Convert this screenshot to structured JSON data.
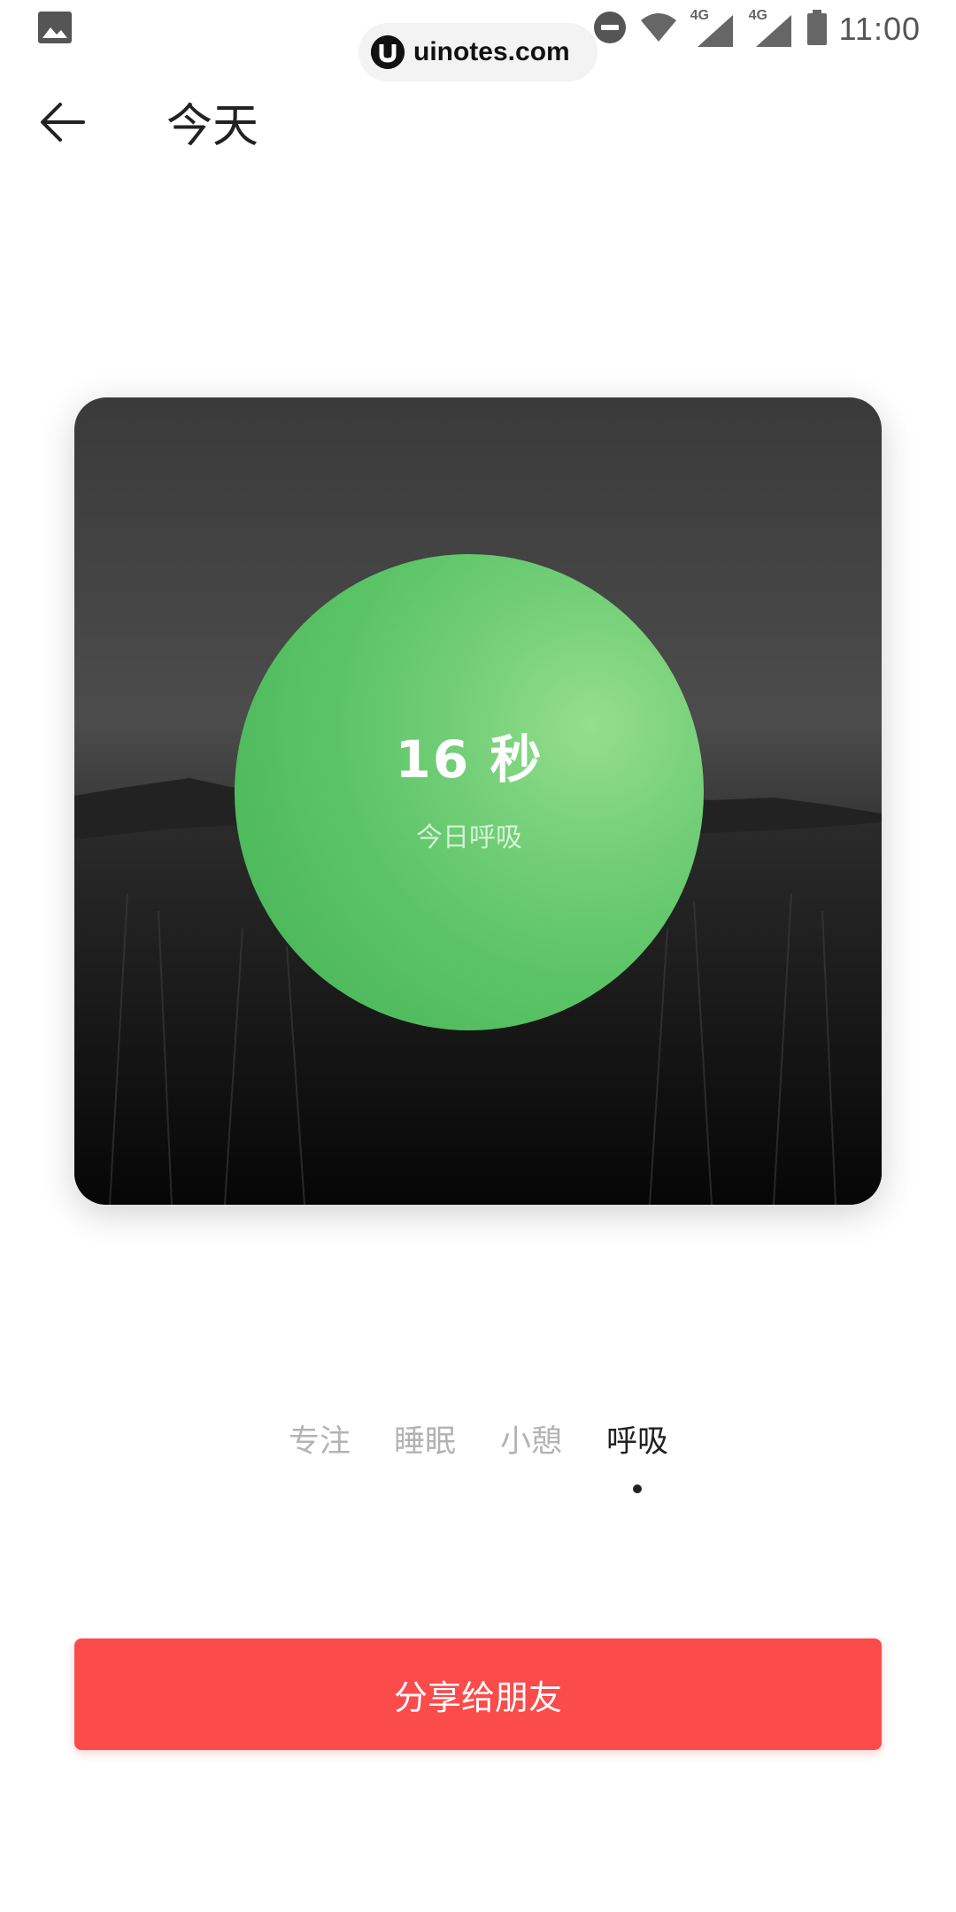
{
  "status_bar": {
    "time": "11:00",
    "network_1": "4G",
    "network_2": "4G",
    "icons": [
      "image-icon",
      "do-not-disturb-icon",
      "wifi-icon",
      "signal-icon",
      "signal-icon",
      "battery-icon"
    ]
  },
  "watermark": {
    "text": "uinotes.com"
  },
  "header": {
    "back_icon": "arrow-left-icon",
    "title": "今天"
  },
  "card": {
    "value": "16 秒",
    "label": "今日呼吸",
    "circle_color": "#5bc466"
  },
  "tabs": {
    "items": [
      {
        "label": "专注",
        "active": false
      },
      {
        "label": "睡眠",
        "active": false
      },
      {
        "label": "小憩",
        "active": false
      },
      {
        "label": "呼吸",
        "active": true
      }
    ]
  },
  "share": {
    "label": "分享给朋友",
    "color": "#fb4b4b"
  }
}
